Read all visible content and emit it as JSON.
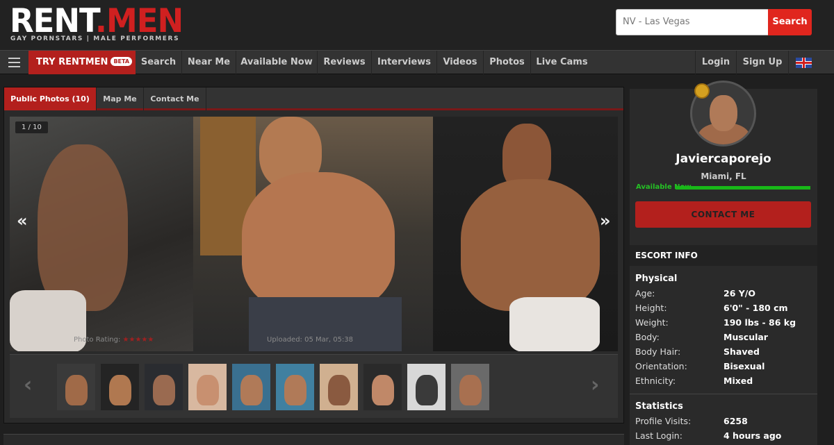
{
  "header": {
    "logo": {
      "part1": "RENT",
      "dot": ".",
      "part2": "MEN"
    },
    "tagline": "GAY PORNSTARS | MALE PERFORMERS",
    "search": {
      "value": "NV - Las Vegas",
      "button": "Search"
    }
  },
  "nav": {
    "try": "TRY RENTMEN",
    "beta": "BETA",
    "items": [
      "Search",
      "Near Me",
      "Available Now",
      "Reviews",
      "Interviews",
      "Videos",
      "Photos",
      "Live Cams"
    ],
    "right": [
      "Login",
      "Sign Up"
    ]
  },
  "gallery": {
    "tabs": [
      "Public Photos (10)",
      "Map Me",
      "Contact Me"
    ],
    "counter": "1 / 10",
    "prev": "«",
    "next": "»",
    "overlay_rating": "Photo Rating:",
    "overlay_stars": "★★★★★",
    "overlay_uploaded": "Uploaded: 05 Mar, 05:38",
    "thumb_prev": "‹",
    "thumb_next": "›",
    "thumb_count": 10
  },
  "profile": {
    "name": "Javiercaporejo",
    "location": "Miami, FL",
    "availability": "Available Now",
    "contact_button": "CONTACT ME",
    "escort_info_header": "ESCORT INFO",
    "physical_title": "Physical",
    "physical": [
      {
        "label": "Age:",
        "value": "26 Y/O"
      },
      {
        "label": "Height:",
        "value": "6'0\" - 180 cm"
      },
      {
        "label": "Weight:",
        "value": "190 lbs - 86 kg"
      },
      {
        "label": "Body:",
        "value": "Muscular"
      },
      {
        "label": "Body Hair:",
        "value": "Shaved"
      },
      {
        "label": "Orientation:",
        "value": "Bisexual"
      },
      {
        "label": "Ethnicity:",
        "value": "Mixed"
      }
    ],
    "statistics_title": "Statistics",
    "statistics": [
      {
        "label": "Profile Visits:",
        "value": "6258"
      },
      {
        "label": "Last Login:",
        "value": "4 hours ago"
      }
    ]
  },
  "colors": {
    "accent": "#d02020",
    "button_red": "#b3201d",
    "available": "#18b818"
  }
}
